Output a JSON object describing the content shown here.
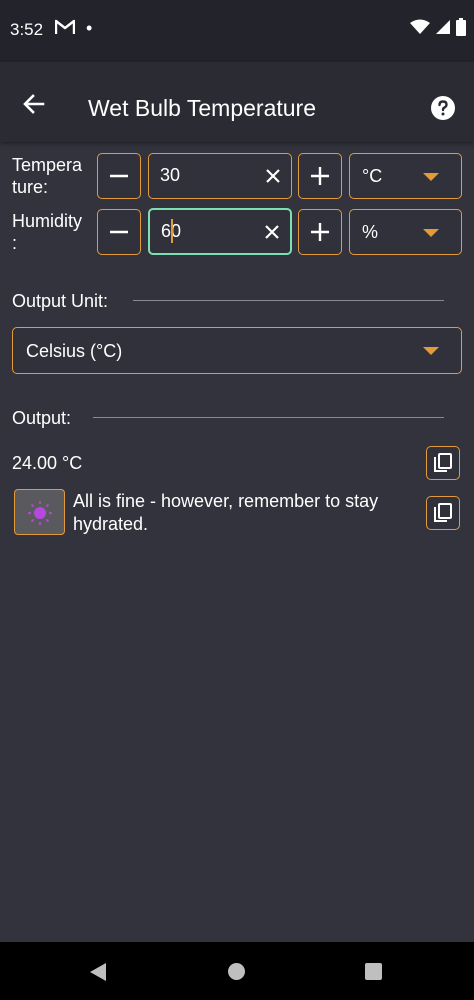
{
  "status_bar": {
    "time": "3:52",
    "dot": "•"
  },
  "app_bar": {
    "title": "Wet Bulb Temperature",
    "back_icon": "arrow-left-icon",
    "help_icon": "help-circle-icon"
  },
  "temperature": {
    "label_line1": "Tempera",
    "label_line2": "ture:",
    "value": "30",
    "unit": "°C"
  },
  "humidity": {
    "label_line1": "Humidity",
    "label_line2": ":",
    "value": "60",
    "unit": "%"
  },
  "output_unit": {
    "label": "Output Unit:",
    "selected": "Celsius (°C)"
  },
  "output": {
    "label": "Output:",
    "value": "24.00 °C",
    "message": "All is fine - however, remember to stay hydrated."
  },
  "colors": {
    "accent": "#e39a3b",
    "focus": "#7ce0b3",
    "background": "#32333d",
    "app_bar": "#2a2b33",
    "sun": "#b548e0"
  }
}
